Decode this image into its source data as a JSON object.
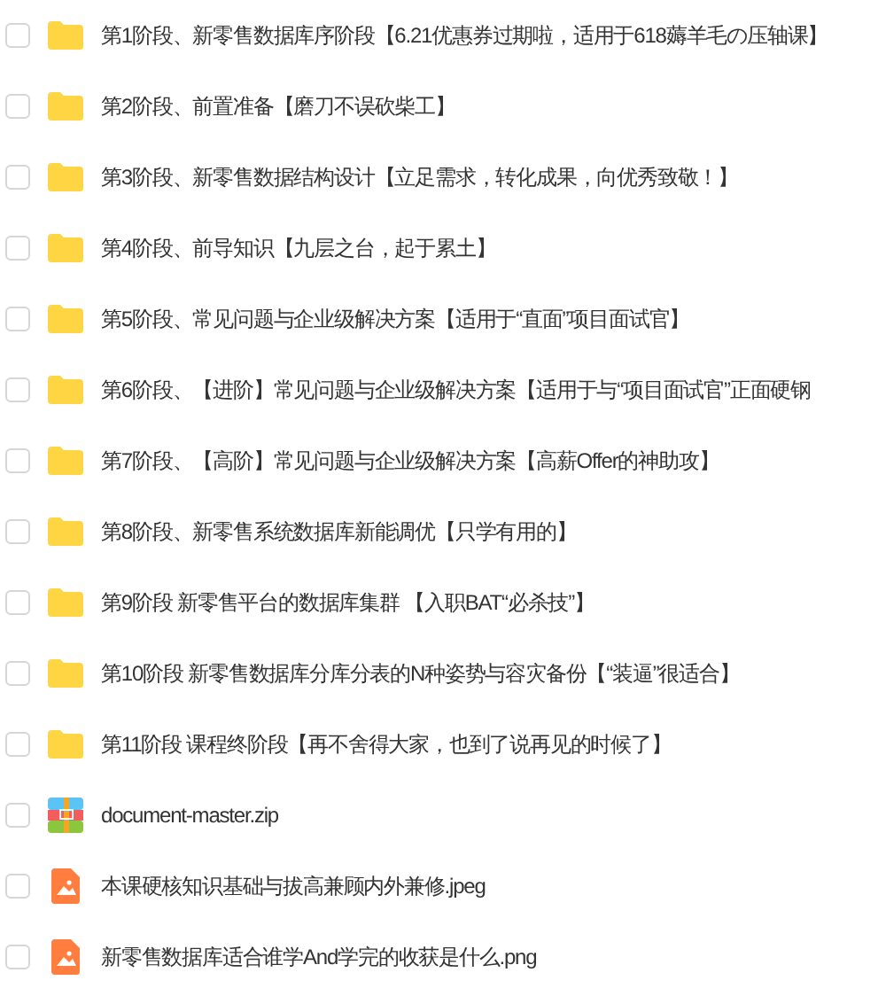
{
  "files": [
    {
      "kind": "folder",
      "name": "第1阶段、新零售数据库序阶段【6.21优惠券过期啦，适用于618薅羊毛の压轴课】",
      "checked": false
    },
    {
      "kind": "folder",
      "name": "第2阶段、前置准备【磨刀不误砍柴工】",
      "checked": false
    },
    {
      "kind": "folder",
      "name": "第3阶段、新零售数据结构设计【立足需求，转化成果，向优秀致敬！】",
      "checked": false
    },
    {
      "kind": "folder",
      "name": "第4阶段、前导知识【九层之台，起于累土】",
      "checked": false
    },
    {
      "kind": "folder",
      "name": "第5阶段、常见问题与企业级解决方案【适用于“直面”项目面试官】",
      "checked": false
    },
    {
      "kind": "folder",
      "name": "第6阶段、【进阶】常见问题与企业级解决方案【适用于与“项目面试官”正面硬钢",
      "checked": false
    },
    {
      "kind": "folder",
      "name": "第7阶段、【高阶】常见问题与企业级解决方案【高薪Offer的神助攻】",
      "checked": false
    },
    {
      "kind": "folder",
      "name": "第8阶段、新零售系统数据库新能调优【只学有用的】",
      "checked": false
    },
    {
      "kind": "folder",
      "name": "第9阶段 新零售平台的数据库集群 【入职BAT“必杀技”】",
      "checked": false
    },
    {
      "kind": "folder",
      "name": "第10阶段 新零售数据库分库分表的N种姿势与容灾备份【“装逼”很适合】",
      "checked": false
    },
    {
      "kind": "folder",
      "name": "第11阶段 课程终阶段【再不舍得大家，也到了说再见的时候了】",
      "checked": false
    },
    {
      "kind": "zip",
      "name": "document-master.zip",
      "checked": false
    },
    {
      "kind": "image",
      "name": "本课硬核知识基础与拔高兼顾内外兼修.jpeg",
      "checked": false
    },
    {
      "kind": "image",
      "name": "新零售数据库适合谁学And学完的收获是什么.png",
      "checked": false
    }
  ]
}
